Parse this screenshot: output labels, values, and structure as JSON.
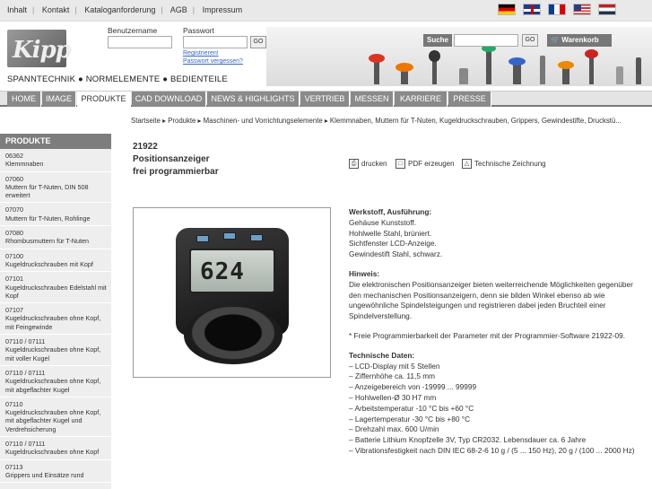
{
  "toplinks": [
    "Inhalt",
    "Kontakt",
    "Kataloganforderung",
    "AGB",
    "Impressum"
  ],
  "flags": [
    "de",
    "en",
    "fr",
    "us",
    "nl"
  ],
  "logo": "Kipp",
  "tagline": "SPANNTECHNIK ● NORMELEMENTE ● BEDIENTEILE",
  "login": {
    "user_label": "Benutzername",
    "pass_label": "Passwort",
    "go": "GO",
    "register": "Registrieren!",
    "forgot": "Passwort vergessen?"
  },
  "search": {
    "label": "Suche",
    "go": "GO"
  },
  "cart": "Warenkorb",
  "nav": [
    "HOME",
    "IMAGE",
    "PRODUKTE",
    "CAD DOWNLOAD",
    "NEWS & HIGHLIGHTS",
    "VERTRIEB",
    "MESSEN",
    "KARRIERE",
    "PRESSE"
  ],
  "breadcrumb": "Startseite ▸ Produkte ▸ Maschinen- und Vorrichtungselemente ▸ Klemmnaben, Muttern für T-Nuten, Kugeldruckschrauben, Grippers, Gewindestifte, Druckstü...",
  "sidebar": {
    "title": "PRODUKTE",
    "items": [
      {
        "code": "06362",
        "label": "Klemmnaben"
      },
      {
        "code": "07060",
        "label": "Muttern für T-Nuten, DIN 508 erweitert"
      },
      {
        "code": "07070",
        "label": "Muttern für T-Nuten, Rohlinge"
      },
      {
        "code": "07080",
        "label": "Rhombusmuttern für T-Nuten"
      },
      {
        "code": "07100",
        "label": "Kugeldruckschrauben mit Kopf"
      },
      {
        "code": "07101",
        "label": "Kugeldruckschrauben Edelstahl mit Kopf"
      },
      {
        "code": "07107",
        "label": "Kugeldruckschrauben ohne Kopf, mit Feingewinde"
      },
      {
        "code": "07110 / 07111",
        "label": "Kugeldruckschrauben ohne Kopf, mit voller Kugel"
      },
      {
        "code": "07110 / 07111",
        "label": "Kugeldruckschrauben ohne Kopf, mit abgeflachter Kugel"
      },
      {
        "code": "07110",
        "label": "Kugeldruckschrauben ohne Kopf, mit abgeflachter Kugel und Verdrehsicherung"
      },
      {
        "code": "07110 / 07111",
        "label": "Kugeldruckschrauben ohne Kopf"
      },
      {
        "code": "07113",
        "label": "Grippers und Einsätze rund"
      }
    ]
  },
  "product": {
    "code": "21922",
    "title1": "Positionsanzeiger",
    "title2": "frei programmierbar",
    "display_value": "624"
  },
  "actions": [
    "drucken",
    "PDF erzeugen",
    "Technische Zeichnung"
  ],
  "desc": {
    "material_head": "Werkstoff, Ausführung:",
    "material": [
      "Gehäuse Kunststoff.",
      "Hohlwelle Stahl, brüniert.",
      "Sichtfenster LCD-Anzeige.",
      "Gewindestift Stahl, schwarz."
    ],
    "hint_head": "Hinweis:",
    "hint": "Die elektronischen Positionsanzeiger bieten weiterreichende Möglichkeiten gegenüber den mechanischen Positionsanzeigern, denn sie bilden Winkel ebenso ab wie ungewöhnliche Spindelsteigungen und registrieren dabei jeden Bruchteil einer Spindelverstellung.",
    "note": "* Freie Programmierbarkeit der Parameter mit der Programmier-Software 21922-09.",
    "tech_head": "Technische Daten:",
    "tech": [
      "– LCD-Display mit 5 Stellen",
      "– Ziffernhöhe ca. 11,5 mm",
      "– Anzeigebereich von -19999 ... 99999",
      "– Hohlwellen-Ø 30 H7 mm",
      "– Arbeitstemperatur -10 °C bis +60 °C",
      "– Lagertemperatur -30 °C bis +80 °C",
      "– Drehzahl max. 600 U/min",
      "– Batterie Lithium Knopfzelle 3V, Typ CR2032. Lebensdauer ca. 6 Jahre",
      "– Vibrationsfestigkeit nach DIN IEC 68-2-6 10 g / (5 ... 150 Hz), 20 g / (100 ... 2000 Hz)"
    ]
  }
}
